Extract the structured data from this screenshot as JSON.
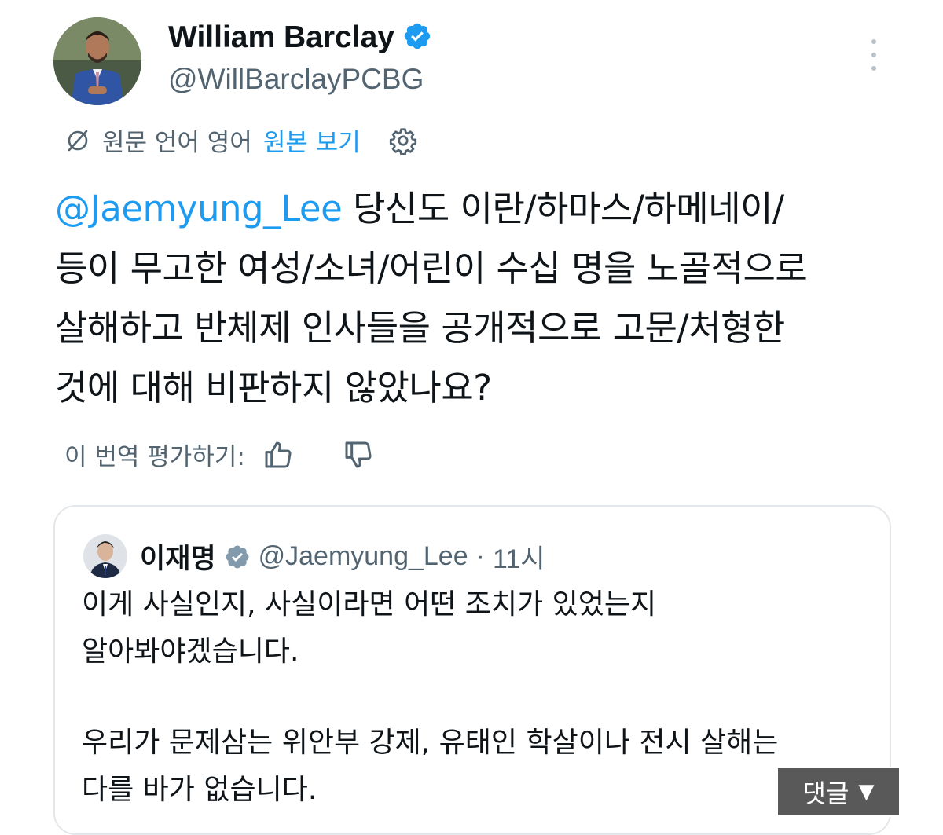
{
  "author": {
    "name": "William Barclay",
    "handle": "@WillBarclayPCBG",
    "verified": true
  },
  "translation": {
    "original_language": "원문 언어 영어",
    "show_original": "원본 보기"
  },
  "tweet": {
    "mention": "@Jaemyung_Lee",
    "lines": [
      " 당신도 이란/하마스/하메네이/",
      "등이 무고한 여성/소녀/어린이 수십 명을 노골적으로",
      "살해하고 반체제 인사들을 공개적으로 고문/처형한",
      "것에 대해 비판하지 않았나요?"
    ]
  },
  "rating": {
    "label": "이 번역 평가하기:"
  },
  "quoted": {
    "name": "이재명",
    "handle": "@Jaemyung_Lee",
    "separator": "·",
    "time": "11시",
    "verified": true,
    "paragraph1": [
      "이게 사실인지, 사실이라면 어떤 조치가 있었는지",
      "알아봐야겠습니다."
    ],
    "paragraph2": [
      "우리가 문제삼는 위안부 강제, 유태인 학살이나 전시 살해는",
      "다를 바가 없습니다."
    ]
  },
  "overlay": {
    "comment_label": "댓글",
    "comment_arrow": "▼"
  },
  "colors": {
    "accent": "#1d9bf0",
    "secondary_text": "#536471",
    "verified_badge_author": "#1d9bf0",
    "verified_badge_quoted": "#829aab"
  },
  "icons": {
    "translate": "translate-icon",
    "settings": "gear-icon",
    "like": "thumbs-up-icon",
    "dislike": "thumbs-down-icon",
    "more": "more-vertical-icon",
    "verified": "verified-badge-icon"
  }
}
